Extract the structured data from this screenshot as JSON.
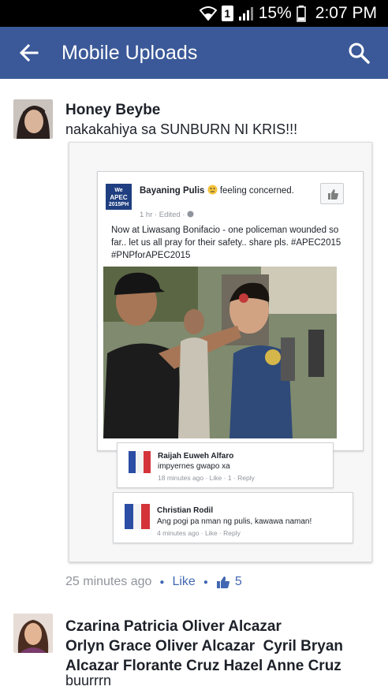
{
  "status_bar": {
    "battery": "15%",
    "time": "2:07 PM",
    "sim_slot": "1"
  },
  "app_bar": {
    "title": "Mobile Uploads",
    "background": "#3b5998"
  },
  "comments": [
    {
      "author": "Honey Beybe",
      "text": "nakakahiya sa SUNBURN NI KRIS!!!",
      "time": "25 minutes ago",
      "like_label": "Like",
      "like_count": "5"
    },
    {
      "author_lines": [
        "Czarina Patricia Oliver Alcazar",
        "Orlyn Grace Oliver Alcazar  Cyril Bryan",
        "Alcazar Florante Cruz Hazel Anne Cruz"
      ],
      "text": "buurrrn"
    }
  ],
  "shared_post": {
    "logo_text": [
      "We",
      "APEC",
      "2015PH"
    ],
    "author": "Bayaning Pulis",
    "feeling": "feeling concerned.",
    "time": "1 hr · Edited ·",
    "text": "Now at Liwasang Bonifacio - one policeman wounded so far.. let us all pray for their safety.. share pls. #APEC2015 #PNPforAPEC2015",
    "replies": [
      {
        "name": "Raijah Euweh Alfaro",
        "text": "impyernes gwapo xa",
        "meta": "18 minutes ago · Like · 1 · Reply"
      },
      {
        "name": "Christian Rodil",
        "text": "Ang pogi pa nman ng pulis, kawawa naman!",
        "meta": "4 minutes ago · Like · Reply"
      }
    ]
  },
  "colors": {
    "link_blue": "#4267b2",
    "meta_gray": "#90949c"
  },
  "icons": [
    "back-arrow-icon",
    "search-icon",
    "wifi-icon",
    "signal-icon",
    "battery-icon",
    "thumbs-up-icon",
    "neutral-face-icon",
    "globe-icon"
  ]
}
